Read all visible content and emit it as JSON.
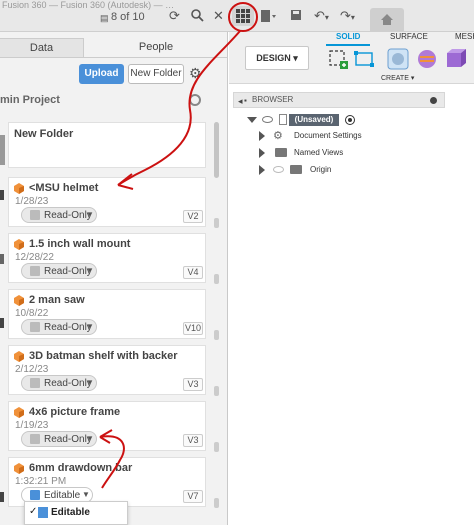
{
  "topbar": {
    "faded_text": "Fusion 360 — Fusion 360 (Autodesk) — …",
    "pager": "8 of 10"
  },
  "data_panel": {
    "tabs": [
      "Data",
      "People"
    ],
    "upload_label": "Upload",
    "new_folder_label": "New Folder",
    "project_name": "min Project",
    "folder_card_title": "New Folder",
    "items": [
      {
        "title": "<MSU helmet",
        "date": "1/28/23",
        "status": "Read-Only",
        "version": "V2"
      },
      {
        "title": "1.5 inch wall mount",
        "date": "12/28/22",
        "status": "Read-Only",
        "version": "V4"
      },
      {
        "title": "2 man saw",
        "date": "10/8/22",
        "status": "Read-Only",
        "version": "V10"
      },
      {
        "title": "3D batman shelf with backer",
        "date": "2/12/23",
        "status": "Read-Only",
        "version": "V3"
      },
      {
        "title": "4x6 picture frame",
        "date": "1/19/23",
        "status": "Read-Only",
        "version": "V3"
      },
      {
        "title": "6mm drawdown bar",
        "date": "1:32:21 PM",
        "status": "Editable",
        "version": "V7"
      }
    ],
    "dropdown_option": "Editable"
  },
  "workspace": {
    "design_label": "DESIGN ▾",
    "ribbon_tabs": [
      "SOLID",
      "SURFACE",
      "MESH"
    ],
    "create_label": "CREATE ▾",
    "browser_title": "BROWSER",
    "tree": {
      "root": "(Unsaved)",
      "children": [
        "Document Settings",
        "Named Views",
        "Origin"
      ]
    }
  },
  "colors": {
    "accent_blue": "#4a90d9",
    "fusion_blue": "#0696d7",
    "annotation_red": "#cc1111",
    "cube_orange": "#f0913a"
  }
}
